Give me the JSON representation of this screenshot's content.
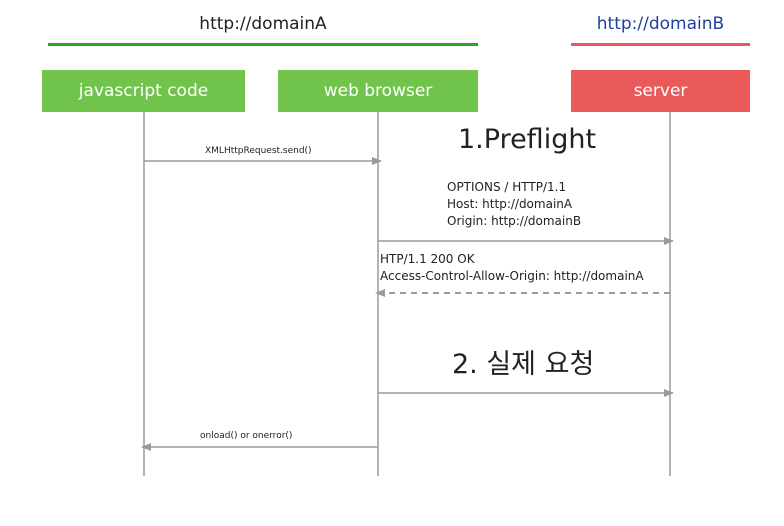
{
  "domains": {
    "a": "http://domainA",
    "b": "http://domainB"
  },
  "actors": {
    "js": "javascript code",
    "browser": "web browser",
    "server": "server"
  },
  "messages": {
    "send": "XMLHttpRequest.send()",
    "preflight_title": "1.Preflight",
    "options_request": {
      "line1": "OPTIONS / HTTP/1.1",
      "line2": "Host: http://domainA",
      "line3": "Origin: http://domainB"
    },
    "options_response": {
      "line1": "HTP/1.1 200 OK",
      "line2": "Access-Control-Allow-Origin: http://domainA"
    },
    "actual_request_title": "2. 실제 요청",
    "callback": "onload() or onerror()"
  },
  "colors": {
    "client_green": "#71c44b",
    "domain_a_line": "#2aa51e",
    "server_red": "#ea5a5a",
    "domain_b_text": "#1f3f9e",
    "line_gray": "#9a9a9a"
  }
}
